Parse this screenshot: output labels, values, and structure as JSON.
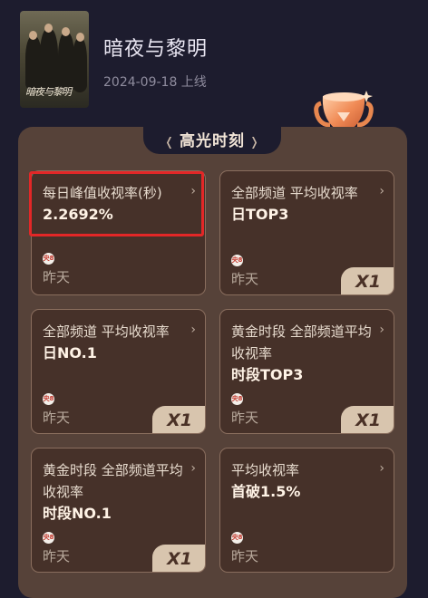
{
  "show": {
    "poster_text": "暗夜与黎明",
    "title": "暗夜与黎明",
    "release": "2024-09-18 上线"
  },
  "highlights": {
    "title": "高光时刻",
    "deco_left": "❬",
    "deco_right": "❭",
    "cards": [
      {
        "label": "每日峰值收视率(秒)",
        "value": "2.2692%",
        "channel_icon": "央8",
        "time": "昨天",
        "badge": ""
      },
      {
        "label": "全部频道 平均收视率",
        "value": "日TOP3",
        "channel_icon": "央8",
        "time": "昨天",
        "badge": "X1"
      },
      {
        "label": "全部频道 平均收视率",
        "value": "日NO.1",
        "channel_icon": "央8",
        "time": "昨天",
        "badge": "X1"
      },
      {
        "label": "黄金时段 全部频道平均收视率",
        "value": "时段TOP3",
        "channel_icon": "央8",
        "time": "昨天",
        "badge": "X1"
      },
      {
        "label": "黄金时段 全部频道平均收视率",
        "value": "时段NO.1",
        "channel_icon": "央8",
        "time": "昨天",
        "badge": "X1"
      },
      {
        "label": "平均收视率",
        "value": "首破1.5%",
        "channel_icon": "央8",
        "time": "昨天",
        "badge": ""
      }
    ]
  },
  "colors": {
    "background": "#1d1c2e",
    "panel": "#564239",
    "card": "#463129",
    "highlight": "#e32727",
    "badge": "#d8c5ae"
  }
}
